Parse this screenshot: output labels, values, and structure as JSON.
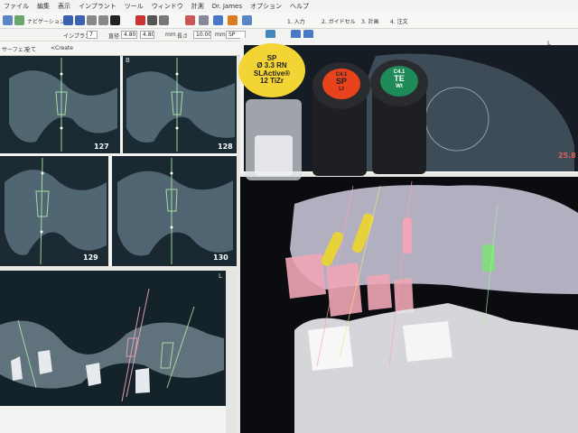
{
  "menu": {
    "items": [
      "ファイル",
      "編集",
      "表示",
      "インプラント",
      "ツール",
      "ウィンドウ",
      "計測",
      "Dr. James",
      "オプション",
      "ヘルプ"
    ]
  },
  "toolbar": {
    "main_labels": {
      "navigate": "ナビゲーション",
      "step1": "1. 入力",
      "step2": "2. ガイドセル",
      "step3": "3. 計画",
      "step4": "4. 注文"
    },
    "secondary": {
      "implant_label": "インプラント",
      "implant_value": "7",
      "diameter_label": "直径",
      "diameter_value": "4.80",
      "length_label": "長さ",
      "length_value": "10.00",
      "unit": "mm",
      "fixture_value": "SP"
    },
    "view": {
      "surface_label": "サーフェス",
      "all_label": "全て",
      "create_label": "<Create"
    }
  },
  "panels": {
    "slice_numbers": [
      "127",
      "128",
      "129",
      "130"
    ],
    "panel_letter_left": "L",
    "panel_letter_b": "B",
    "panel_letter_right": "L",
    "zoom_readout": "25.8"
  },
  "vials": [
    {
      "lines": [
        "SP",
        "Ø 3.3 RN",
        "SLActive®",
        "12 TiZr"
      ],
      "cap_color": "#f2d535"
    },
    {
      "lines": [
        "C4.1",
        "SP",
        "Lt"
      ],
      "cap_color": "#e8431c"
    },
    {
      "lines": [
        "C4.1",
        "TE",
        "Wt"
      ],
      "cap_color": "#1e8a58"
    }
  ],
  "colors": {
    "implant_yellow": "#e8d23a",
    "implant_pink": "#f0a6b5",
    "implant_green": "#7ee07a",
    "bone": "#c9c7d8"
  }
}
